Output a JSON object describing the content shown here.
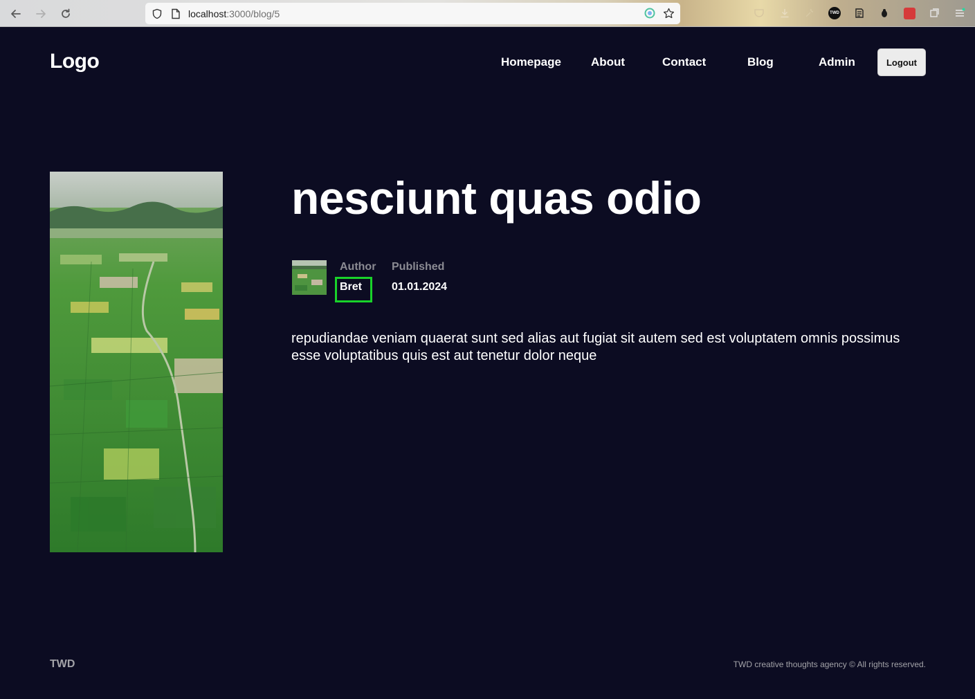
{
  "browser": {
    "url_host": "localhost",
    "url_path": ":3000/blog/5",
    "extension_badge": "TWD"
  },
  "header": {
    "logo": "Logo",
    "nav": [
      {
        "label": "Homepage"
      },
      {
        "label": "About"
      },
      {
        "label": "Contact"
      },
      {
        "label": "Blog"
      },
      {
        "label": "Admin"
      }
    ],
    "logout_label": "Logout"
  },
  "post": {
    "title": "nesciunt quas odio",
    "author_label": "Author",
    "author_name": "Bret",
    "published_label": "Published",
    "published_date": "01.01.2024",
    "body": "repudiandae veniam quaerat sunt sed alias aut fugiat sit autem sed est voluptatem omnis possimus esse voluptatibus quis est aut tenetur dolor neque"
  },
  "footer": {
    "brand": "TWD",
    "copyright": "TWD creative thoughts agency © All rights reserved."
  },
  "colors": {
    "background": "#0c0c22",
    "highlight": "#19d32a",
    "muted_text": "#8b8b93"
  },
  "icons": {
    "back": "arrow-left-icon",
    "forward": "arrow-right-icon",
    "reload": "reload-icon",
    "shield": "shield-icon",
    "page": "page-icon",
    "star": "bookmark-star-icon"
  }
}
